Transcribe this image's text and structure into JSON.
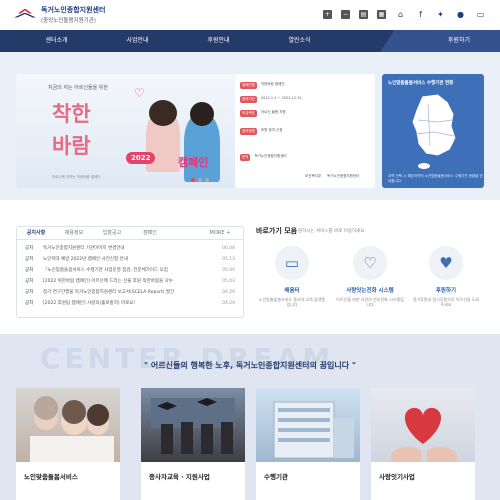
{
  "header": {
    "org_name": "독거노인종합지원센터",
    "org_sub": "(중앙노인돌봄지원기관)"
  },
  "top_tools": [
    "font-plus-icon",
    "font-minus-icon",
    "print-icon",
    "sitemap-icon"
  ],
  "sns": [
    "home-icon",
    "facebook-icon",
    "twitter-icon",
    "chat-icon",
    "blog-icon"
  ],
  "nav": {
    "items": [
      "센터소개",
      "사업안내",
      "후원안내",
      "열린소식"
    ],
    "highlight": "후원하기"
  },
  "banner": {
    "subtitle": "지금의 저는 어르신들을 위한",
    "line1": "착한",
    "line2": "바람",
    "year": "2022",
    "campaign": "캠페인",
    "footer": "어르신께 전하는 착한바람 캠페인"
  },
  "info_card": {
    "rows": [
      {
        "tag": "캠페인명",
        "text": "착한바람 캠페인"
      },
      {
        "tag": "참여기간",
        "text": "2022.1.1 ~ 2022.12.31"
      },
      {
        "tag": "모금목표",
        "text": "어르신 돌봄 지원"
      },
      {
        "tag": "참여방법",
        "text": "후원 참여 신청"
      },
      {
        "tag": "문의",
        "text": "독거노인종합지원센터"
      }
    ],
    "logos": [
      "보건복지부",
      "독거노인종합지원센터"
    ]
  },
  "map_card": {
    "title": "노인맞춤돌봄서비스 수행기관 현황",
    "footer": "지역 선택 시 해당지역의 노인맞춤돌봄서비스 수행기관 현황을 안내합니다"
  },
  "notice": {
    "tabs": [
      "공지사항",
      "채용정보",
      "입찰공고",
      "캠페인"
    ],
    "more": "MORE +",
    "rows": [
      {
        "cat": "공지",
        "title": "독거노인종합지원센터 기관이미지 변경안내",
        "date": "06.08"
      },
      {
        "cat": "공지",
        "title": "노인학대 예방 2022년 캠페인 사전신청 안내",
        "date": "05.13"
      },
      {
        "cat": "공지",
        "title": "『노인맞춤돌봄서비스 수행기관 사업운영 점검, 전문체가이드 모집",
        "date": "05.09"
      },
      {
        "cat": "공지",
        "title": "[2022 위한바람 캠페인] 어르신께 드리는 선물 후원 착한바람을 나누",
        "date": "05.02"
      },
      {
        "cat": "공지",
        "title": "정기 연구간행물 독거노인종합지원센터 보고서(SCELA Report) 발간",
        "date": "04.29"
      },
      {
        "cat": "공지",
        "title": "[2022 후원팀 캠페인] 사랑의(홀로홈히) 마로요!",
        "date": "04.29"
      }
    ]
  },
  "quick": {
    "title": "바로가기 모음",
    "desc": "원하시는 서비스를 바로 이용하세요",
    "items": [
      {
        "label": "배움터",
        "desc": "노인맞춤돌봄서비스 종사자 교육 플랫폼입니다",
        "icon": "monitor-icon"
      },
      {
        "label": "사랑잇는전화 시스템",
        "desc": "어르신을 위한 사랑의 안부전화 시스템입니다",
        "icon": "heart-phone-icon"
      },
      {
        "label": "후원하기",
        "desc": "정기후원과 일시후원으로 어르신을 도와주세요",
        "icon": "donate-icon"
      }
    ]
  },
  "dream": {
    "bg_text": "CENTER DREAM",
    "slogan": "\" 어르신들의 행복한 노후, 독거노인종합지원센터의 꿈입니다 \""
  },
  "cards": [
    {
      "label": "노인맞춤돌봄서비스"
    },
    {
      "label": "종사자교육 · 지원사업"
    },
    {
      "label": "수행기관"
    },
    {
      "label": "사랑잇기사업"
    }
  ],
  "colors": {
    "navy": "#243b6a",
    "accent_red": "#d6263a",
    "pink": "#e96a83",
    "map_blue": "#3d70b8",
    "link_blue": "#2b5ba6"
  }
}
